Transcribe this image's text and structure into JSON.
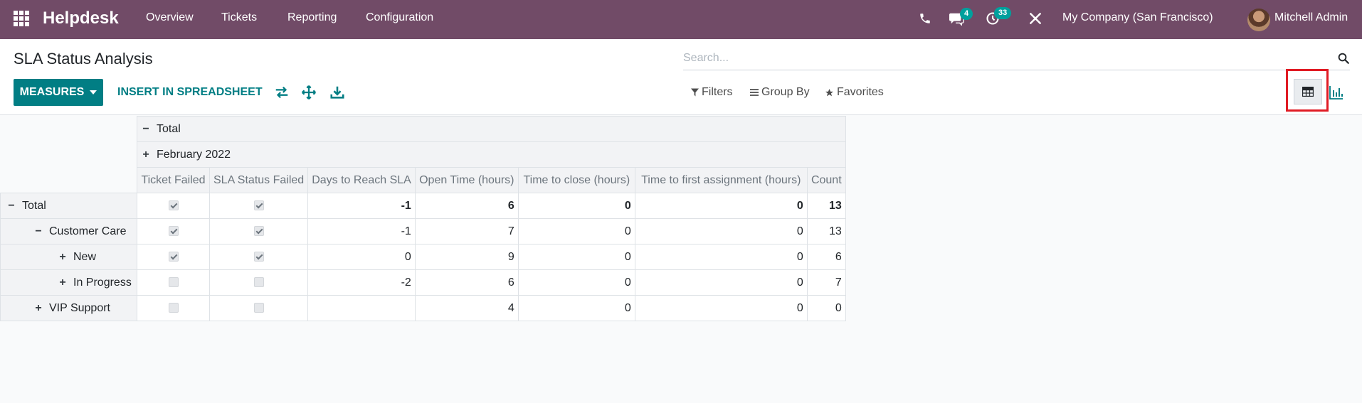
{
  "navbar": {
    "brand": "Helpdesk",
    "menu": [
      "Overview",
      "Tickets",
      "Reporting",
      "Configuration"
    ],
    "messages_badge": "4",
    "activities_badge": "33",
    "company": "My Company (San Francisco)",
    "user": "Mitchell Admin",
    "bg_color": "#714b67"
  },
  "control_panel": {
    "title": "SLA Status Analysis",
    "search_placeholder": "Search...",
    "measures_label": "MEASURES",
    "insert_label": "INSERT IN SPREADSHEET",
    "filters_label": "Filters",
    "groupby_label": "Group By",
    "favorites_label": "Favorites",
    "tool_icons": [
      "flip-axis-icon",
      "expand-all-icon",
      "download-icon"
    ],
    "views": [
      "pivot-view-icon",
      "graph-view-icon"
    ],
    "active_view": "pivot-view-icon",
    "accent_color": "#017e84"
  },
  "pivot": {
    "col_total": "Total",
    "col_group": "February 2022",
    "measures": [
      "Ticket Failed",
      "SLA Status Failed",
      "Days to Reach SLA",
      "Open Time (hours)",
      "Time to close (hours)",
      "Time to first assignment (hours)",
      "Count"
    ],
    "rows": [
      {
        "label": "Total",
        "level": 0,
        "expanded": true,
        "ticket_failed": true,
        "sla_failed": true,
        "days": "-1",
        "open": "6",
        "close": "0",
        "first": "0",
        "count": "13"
      },
      {
        "label": "Customer Care",
        "level": 1,
        "expanded": true,
        "ticket_failed": true,
        "sla_failed": true,
        "days": "-1",
        "open": "7",
        "close": "0",
        "first": "0",
        "count": "13"
      },
      {
        "label": "New",
        "level": 2,
        "expanded": false,
        "ticket_failed": true,
        "sla_failed": true,
        "days": "0",
        "open": "9",
        "close": "0",
        "first": "0",
        "count": "6"
      },
      {
        "label": "In Progress",
        "level": 2,
        "expanded": false,
        "ticket_failed": false,
        "sla_failed": false,
        "days": "-2",
        "open": "6",
        "close": "0",
        "first": "0",
        "count": "7"
      },
      {
        "label": "VIP Support",
        "level": 1,
        "expanded": false,
        "ticket_failed": false,
        "sla_failed": false,
        "days": "",
        "open": "4",
        "close": "0",
        "first": "0",
        "count": "0"
      }
    ]
  }
}
